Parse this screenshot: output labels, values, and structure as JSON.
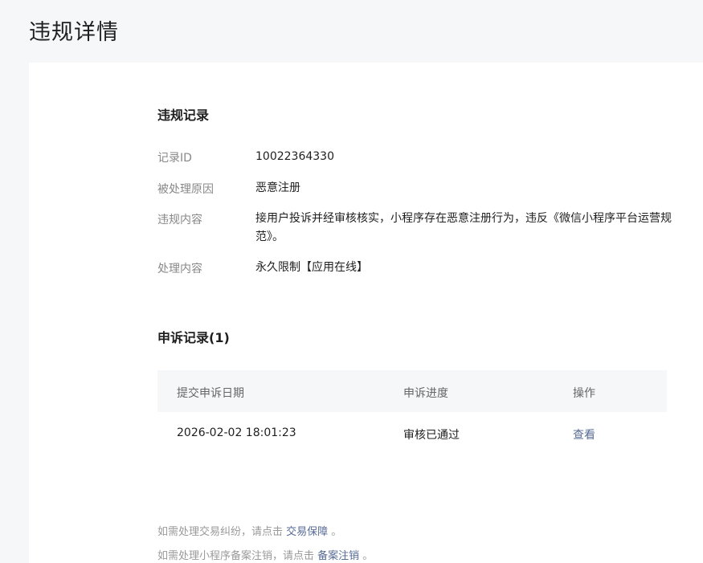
{
  "page": {
    "title": "违规详情"
  },
  "violation": {
    "section_title": "违规记录",
    "fields": [
      {
        "label": "记录ID",
        "value": "10022364330"
      },
      {
        "label": "被处理原因",
        "value": "恶意注册"
      },
      {
        "label": "违规内容",
        "value_line1": "接用户投诉并经审核核实，小程序存在恶意注册行为，违反《微信小程序平台运营规",
        "value_line2": "范》。"
      },
      {
        "label": "处理内容",
        "value": "永久限制【应用在线】"
      }
    ]
  },
  "appeal": {
    "section_title": "申诉记录(1)",
    "headers": [
      "提交申诉日期",
      "申诉进度",
      "操作"
    ],
    "rows": [
      {
        "date": "2026-02-02 18:01:23",
        "status": "审核已通过",
        "action": "查看"
      }
    ]
  },
  "notes": [
    {
      "prefix": "如需处理交易纠纷，请点击 ",
      "link": "交易保障",
      "suffix": " 。"
    },
    {
      "prefix": "如需处理小程序备案注销，请点击 ",
      "link": "备案注销",
      "suffix": " 。"
    }
  ]
}
